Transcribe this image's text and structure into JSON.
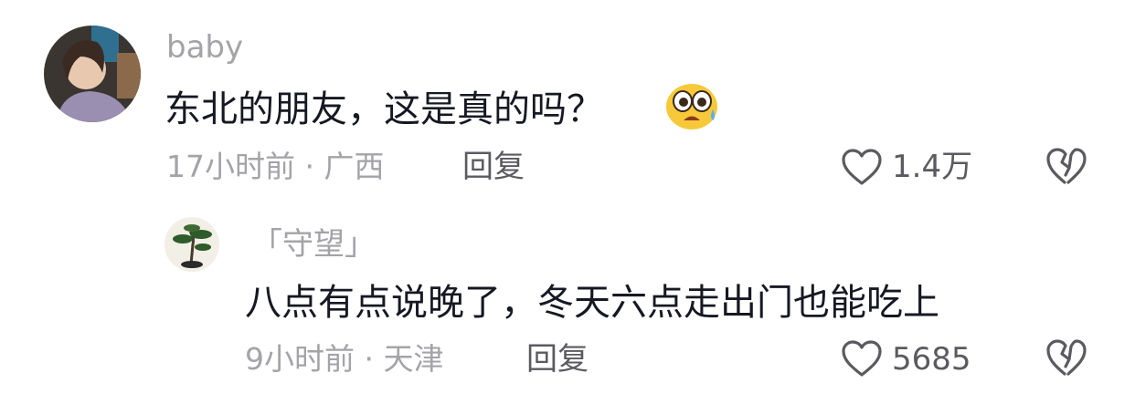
{
  "comments": [
    {
      "username": "baby",
      "text": "东北的朋友，这是真的吗？",
      "emoji": "scared-face-emoji",
      "time": "17小时前",
      "separator": "·",
      "location": "广西",
      "reply_label": "回复",
      "likes": "1.4万"
    },
    {
      "username": "「守望」",
      "text": "八点有点说晚了，冬天六点走出门也能吃上",
      "time": "9小时前",
      "separator": "·",
      "location": "天津",
      "reply_label": "回复",
      "likes": "5685"
    }
  ],
  "icons": {
    "like": "heart-outline-icon",
    "dislike": "broken-heart-outline-icon"
  },
  "colors": {
    "primary_text": "#161823",
    "secondary_text": "#a3a3a8",
    "action_text": "#5a5a60",
    "background": "#ffffff"
  }
}
